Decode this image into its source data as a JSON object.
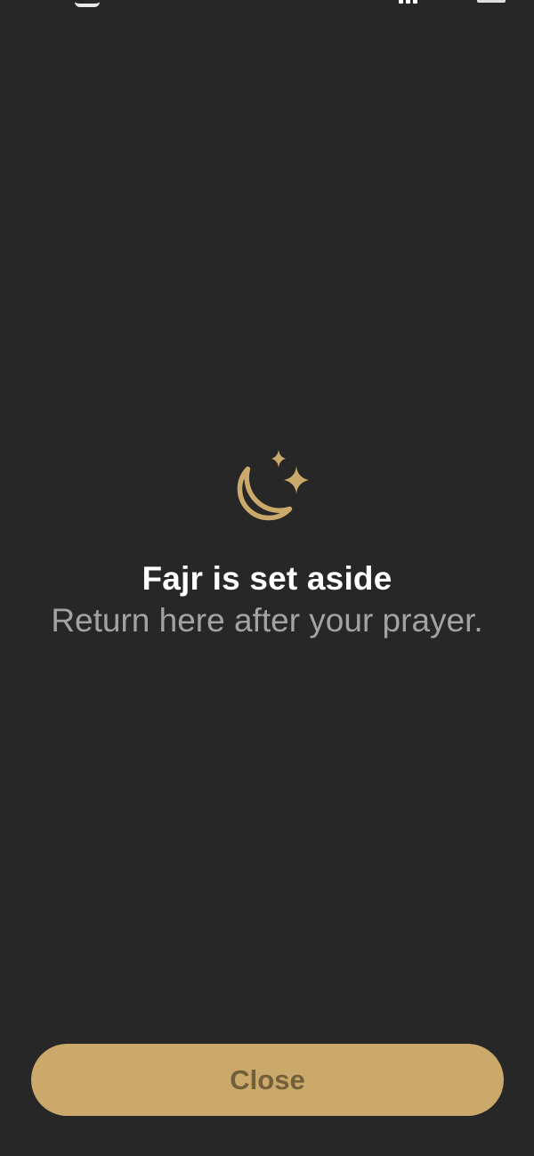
{
  "screen": {
    "title": "Fajr is set aside",
    "subtitle": "Return here after your prayer.",
    "icon": "crescent-moon-stars-icon",
    "close_label": "Close"
  },
  "colors": {
    "background": "#282727",
    "accent": "#cba96a",
    "title_text": "#ffffff",
    "subtitle_text": "#a3a3a3",
    "button_text": "#735f3a"
  }
}
